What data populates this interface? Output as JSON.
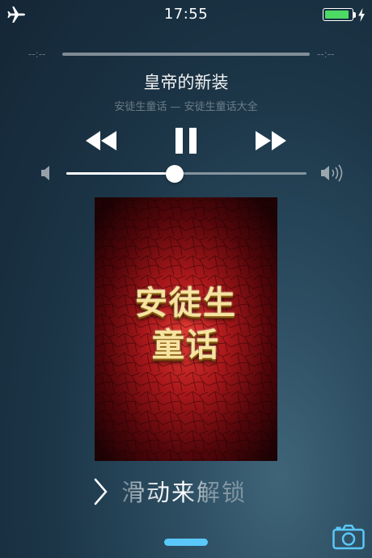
{
  "status_bar": {
    "time": "17:55",
    "airplane_icon": "airplane-icon",
    "battery_icon": "battery-icon",
    "battery_level": 0.95,
    "charging_icon": "lightning-bolt-icon",
    "battery_color": "#4cd964"
  },
  "now_playing": {
    "elapsed": "--:--",
    "remaining": "--:--",
    "title": "皇帝的新装",
    "subtitle": "安徒生童话 — 安徒生童话大全",
    "rewind_icon": "rewind-icon",
    "pause_icon": "pause-icon",
    "forward_icon": "fast-forward-icon",
    "volume_low_icon": "speaker-low-icon",
    "volume_high_icon": "speaker-high-icon",
    "volume_level": 0.45
  },
  "artwork": {
    "line1": "安徒生",
    "line2": "童话"
  },
  "lock": {
    "slide_text": "滑动来解锁",
    "chevron_icon": "chevron-right-icon",
    "camera_icon": "camera-icon",
    "grabber_color": "#5ac8fa"
  }
}
